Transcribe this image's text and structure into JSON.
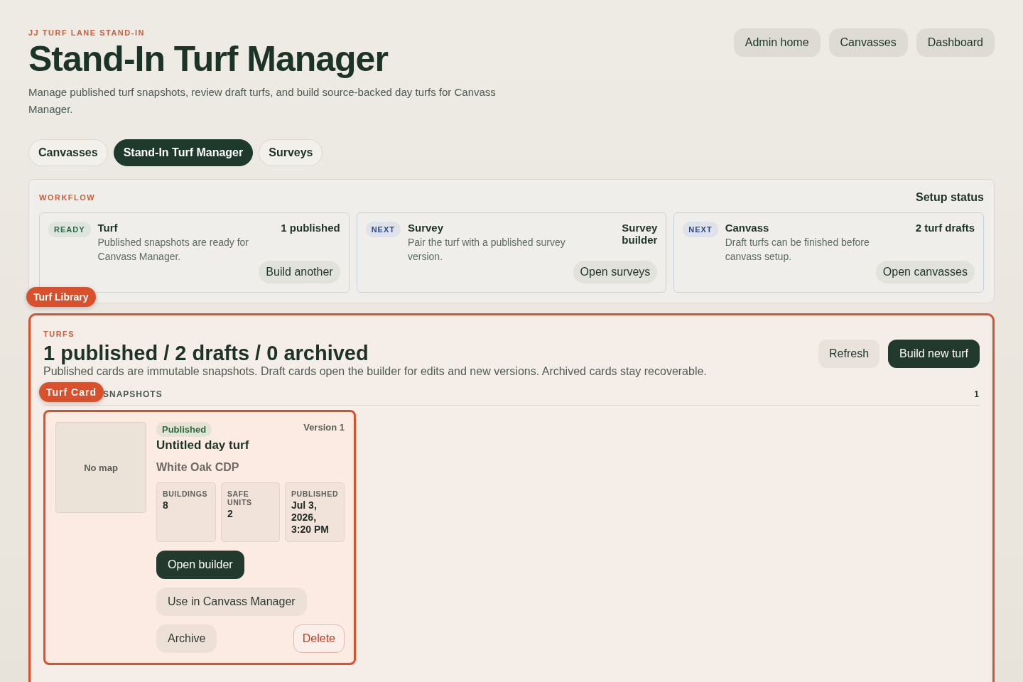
{
  "header": {
    "eyebrow": "JJ TURF LANE STAND-IN",
    "title": "Stand-In Turf Manager",
    "description": "Manage published turf snapshots, review draft turfs, and build source-backed day turfs for Canvass Manager."
  },
  "top_links": [
    "Admin home",
    "Canvasses",
    "Dashboard"
  ],
  "tabs": [
    {
      "label": "Canvasses",
      "selected": false
    },
    {
      "label": "Stand-In Turf Manager",
      "selected": true
    },
    {
      "label": "Surveys",
      "selected": false
    }
  ],
  "workflow": {
    "eyebrow": "WORKFLOW",
    "status_title": "Setup status",
    "steps": [
      {
        "kind": "ready",
        "tag": "READY",
        "title": "Turf",
        "description": "Published snapshots are ready for Canvass Manager.",
        "summary": "1 published",
        "action": "Build another"
      },
      {
        "kind": "next",
        "tag": "NEXT",
        "title": "Survey",
        "description": "Pair the turf with a published survey version.",
        "summary": "Survey builder",
        "action": "Open surveys"
      },
      {
        "kind": "next",
        "tag": "NEXT",
        "title": "Canvass",
        "description": "Draft turfs can be finished before canvass setup.",
        "summary": "2 turf drafts",
        "action": "Open canvasses"
      }
    ]
  },
  "library": {
    "annotation": "Turf Library",
    "eyebrow": "TURFS",
    "title": "1 published / 2 drafts / 0 archived",
    "description": "Published cards are immutable snapshots. Draft cards open the builder for edits and new versions. Archived cards stay recoverable.",
    "actions": [
      "Refresh",
      "Build new turf"
    ],
    "section": {
      "annotation": "Turf Card",
      "label": "SNAPSHOTS",
      "count": "1"
    },
    "cards": [
      {
        "map": "No map",
        "status": "Published",
        "version": "Version 1",
        "title": "Untitled day turf",
        "place": "White Oak CDP",
        "stats": [
          {
            "label": "BUILDINGS",
            "value": "8"
          },
          {
            "label": "SAFE UNITS",
            "value": "2"
          },
          {
            "label": "PUBLISHED",
            "value": "Jul 3, 2026, 3:20 PM"
          }
        ],
        "primary": "Open builder",
        "secondary": "Use in Canvass Manager",
        "archive": "Archive",
        "delete": "Delete"
      }
    ]
  }
}
